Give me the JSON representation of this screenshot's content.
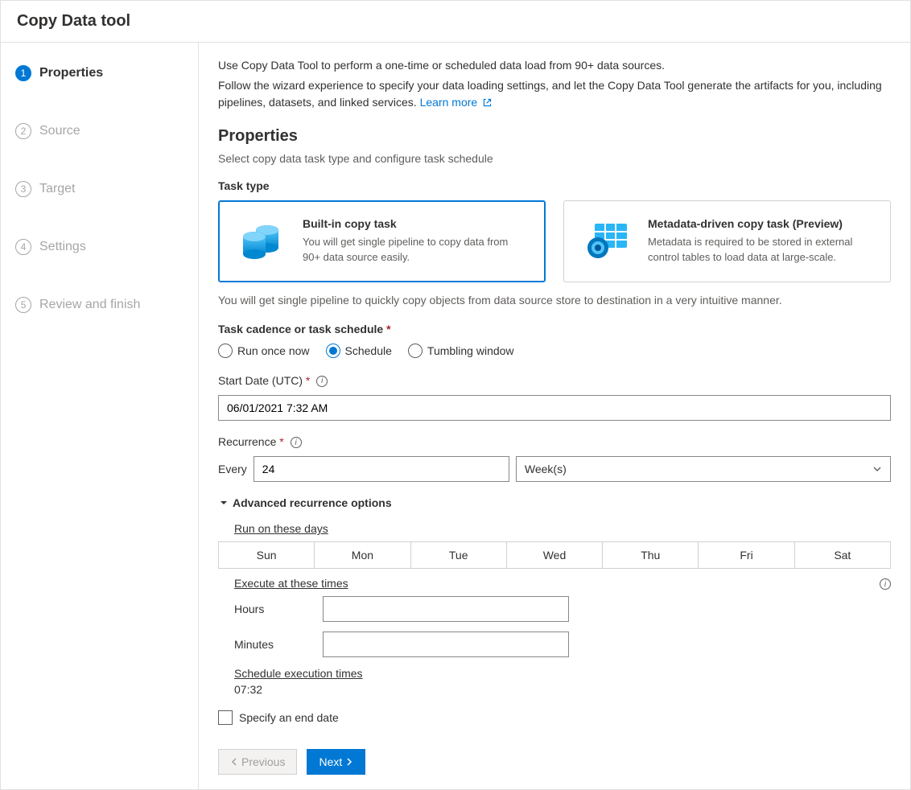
{
  "window": {
    "title": "Copy Data tool"
  },
  "sidebar": {
    "steps": [
      {
        "num": "1",
        "label": "Properties",
        "active": true
      },
      {
        "num": "2",
        "label": "Source",
        "active": false
      },
      {
        "num": "3",
        "label": "Target",
        "active": false
      },
      {
        "num": "4",
        "label": "Settings",
        "active": false
      },
      {
        "num": "5",
        "label": "Review and finish",
        "active": false
      }
    ]
  },
  "intro": {
    "line1": "Use Copy Data Tool to perform a one-time or scheduled data load from 90+ data sources.",
    "line2": "Follow the wizard experience to specify your data loading settings, and let the Copy Data Tool generate the artifacts for you, including pipelines, datasets, and linked services.",
    "learn_more": "Learn more"
  },
  "properties": {
    "title": "Properties",
    "subtitle": "Select copy data task type and configure task schedule",
    "task_type_label": "Task type",
    "cards": {
      "builtin": {
        "title": "Built-in copy task",
        "desc": "You will get single pipeline to copy data from 90+ data source easily."
      },
      "metadata": {
        "title": "Metadata-driven copy task (Preview)",
        "desc": "Metadata is required to be stored in external control tables to load data at large-scale."
      }
    },
    "helper": "You will get single pipeline to quickly copy objects from data source store to destination in a very intuitive manner.",
    "cadence_label": "Task cadence or task schedule",
    "radios": {
      "once": "Run once now",
      "schedule": "Schedule",
      "tumbling": "Tumbling window"
    },
    "start_date_label": "Start Date (UTC)",
    "start_date_value": "06/01/2021 7:32 AM",
    "recurrence_label": "Recurrence",
    "every_label": "Every",
    "every_value": "24",
    "every_unit": "Week(s)",
    "advanced_label": "Advanced recurrence options",
    "run_days_label": "Run on these days",
    "days": [
      "Sun",
      "Mon",
      "Tue",
      "Wed",
      "Thu",
      "Fri",
      "Sat"
    ],
    "execute_label": "Execute at these times",
    "hours_label": "Hours",
    "hours_value": "",
    "minutes_label": "Minutes",
    "minutes_value": "",
    "schedule_exec_label": "Schedule execution times",
    "schedule_exec_value": "07:32",
    "end_date_label": "Specify an end date"
  },
  "footer": {
    "prev": "Previous",
    "next": "Next"
  }
}
